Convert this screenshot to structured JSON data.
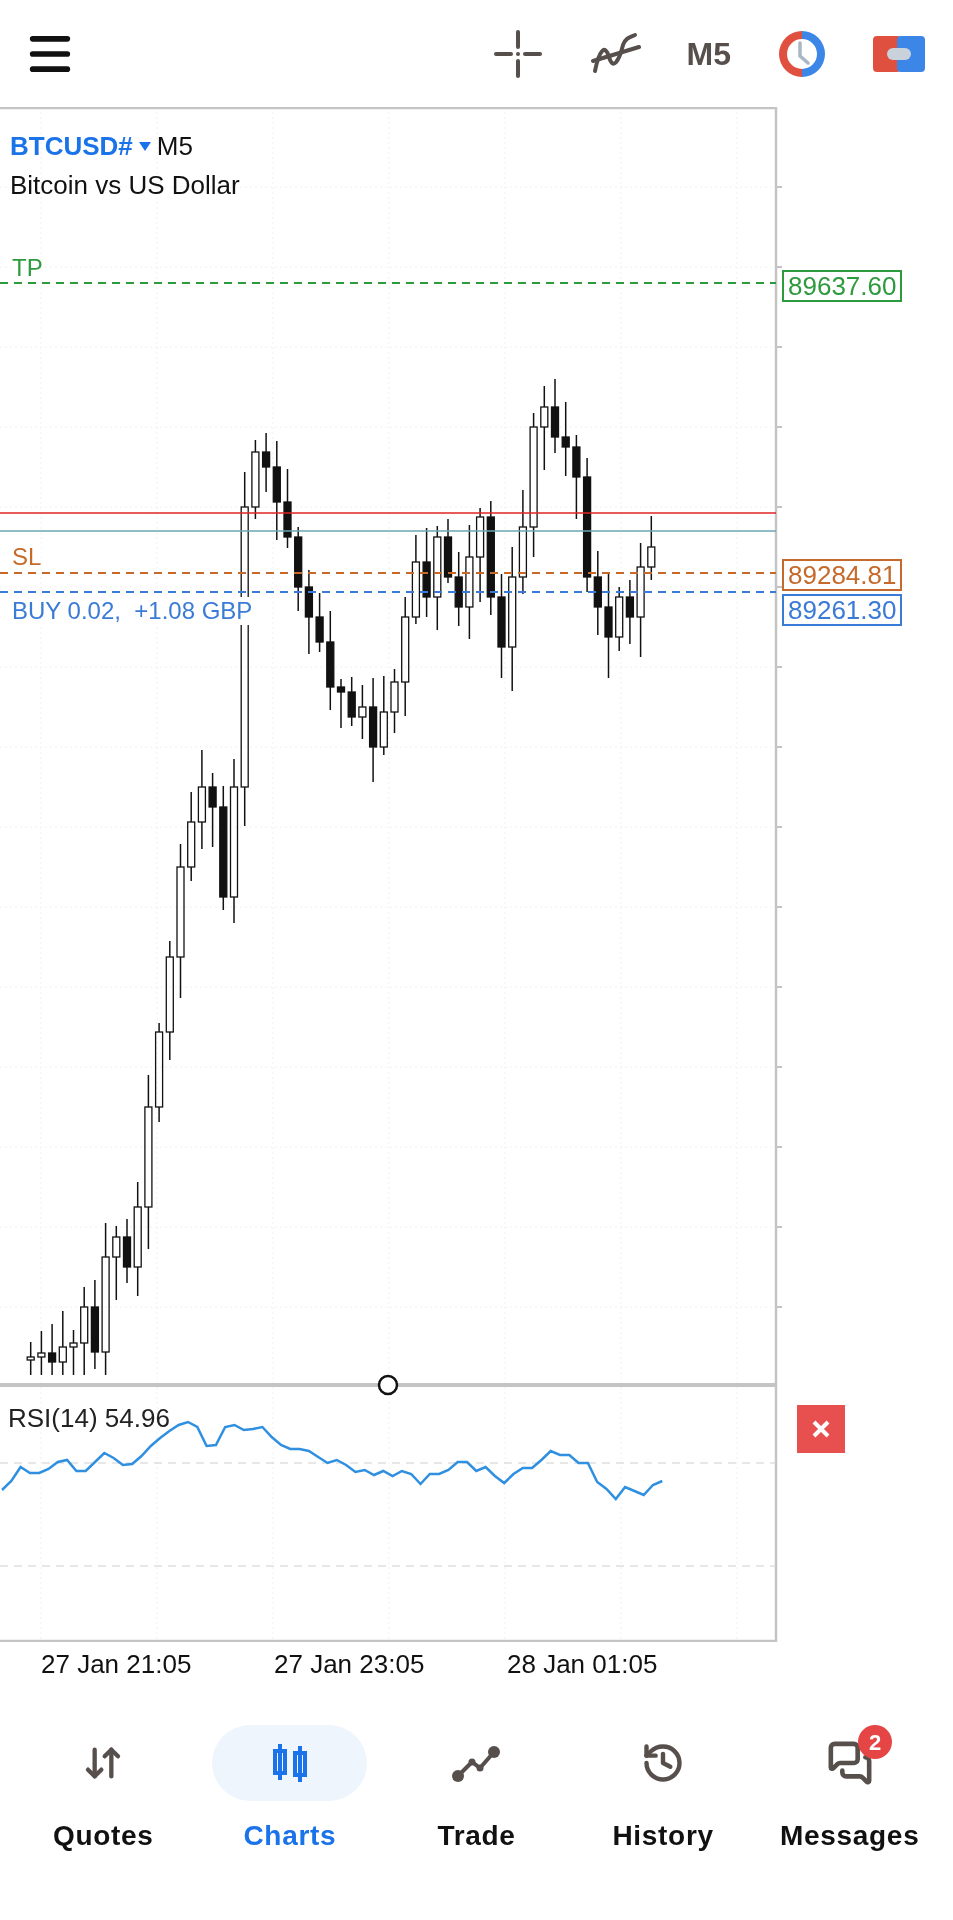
{
  "toolbar": {
    "timeframe": "M5"
  },
  "chart": {
    "symbol": "BTCUSD#",
    "timeframe": "M5",
    "description": "Bitcoin vs US Dollar",
    "lines": [
      {
        "kind": "tp",
        "label": "TP",
        "price": "89637.60",
        "color": "#2e9a3e"
      },
      {
        "kind": "sl",
        "label": "SL",
        "price": "89284.81",
        "color": "#c56a2a"
      },
      {
        "kind": "position",
        "label": "BUY 0.02,  +1.08 GBP",
        "price": "89261.30",
        "color": "#3a7bd5"
      }
    ],
    "indicator": {
      "label": "RSI(14) 54.96"
    },
    "time_labels": [
      "27 Jan 21:05",
      "27 Jan 23:05",
      "28 Jan 01:05"
    ]
  },
  "nav": [
    {
      "kind": "quotes",
      "label": "Quotes",
      "selected": false
    },
    {
      "kind": "charts",
      "label": "Charts",
      "selected": true
    },
    {
      "kind": "trade",
      "label": "Trade",
      "selected": false
    },
    {
      "kind": "history",
      "label": "History",
      "selected": false
    },
    {
      "kind": "messages",
      "label": "Messages",
      "selected": false,
      "badge": "2"
    }
  ]
}
